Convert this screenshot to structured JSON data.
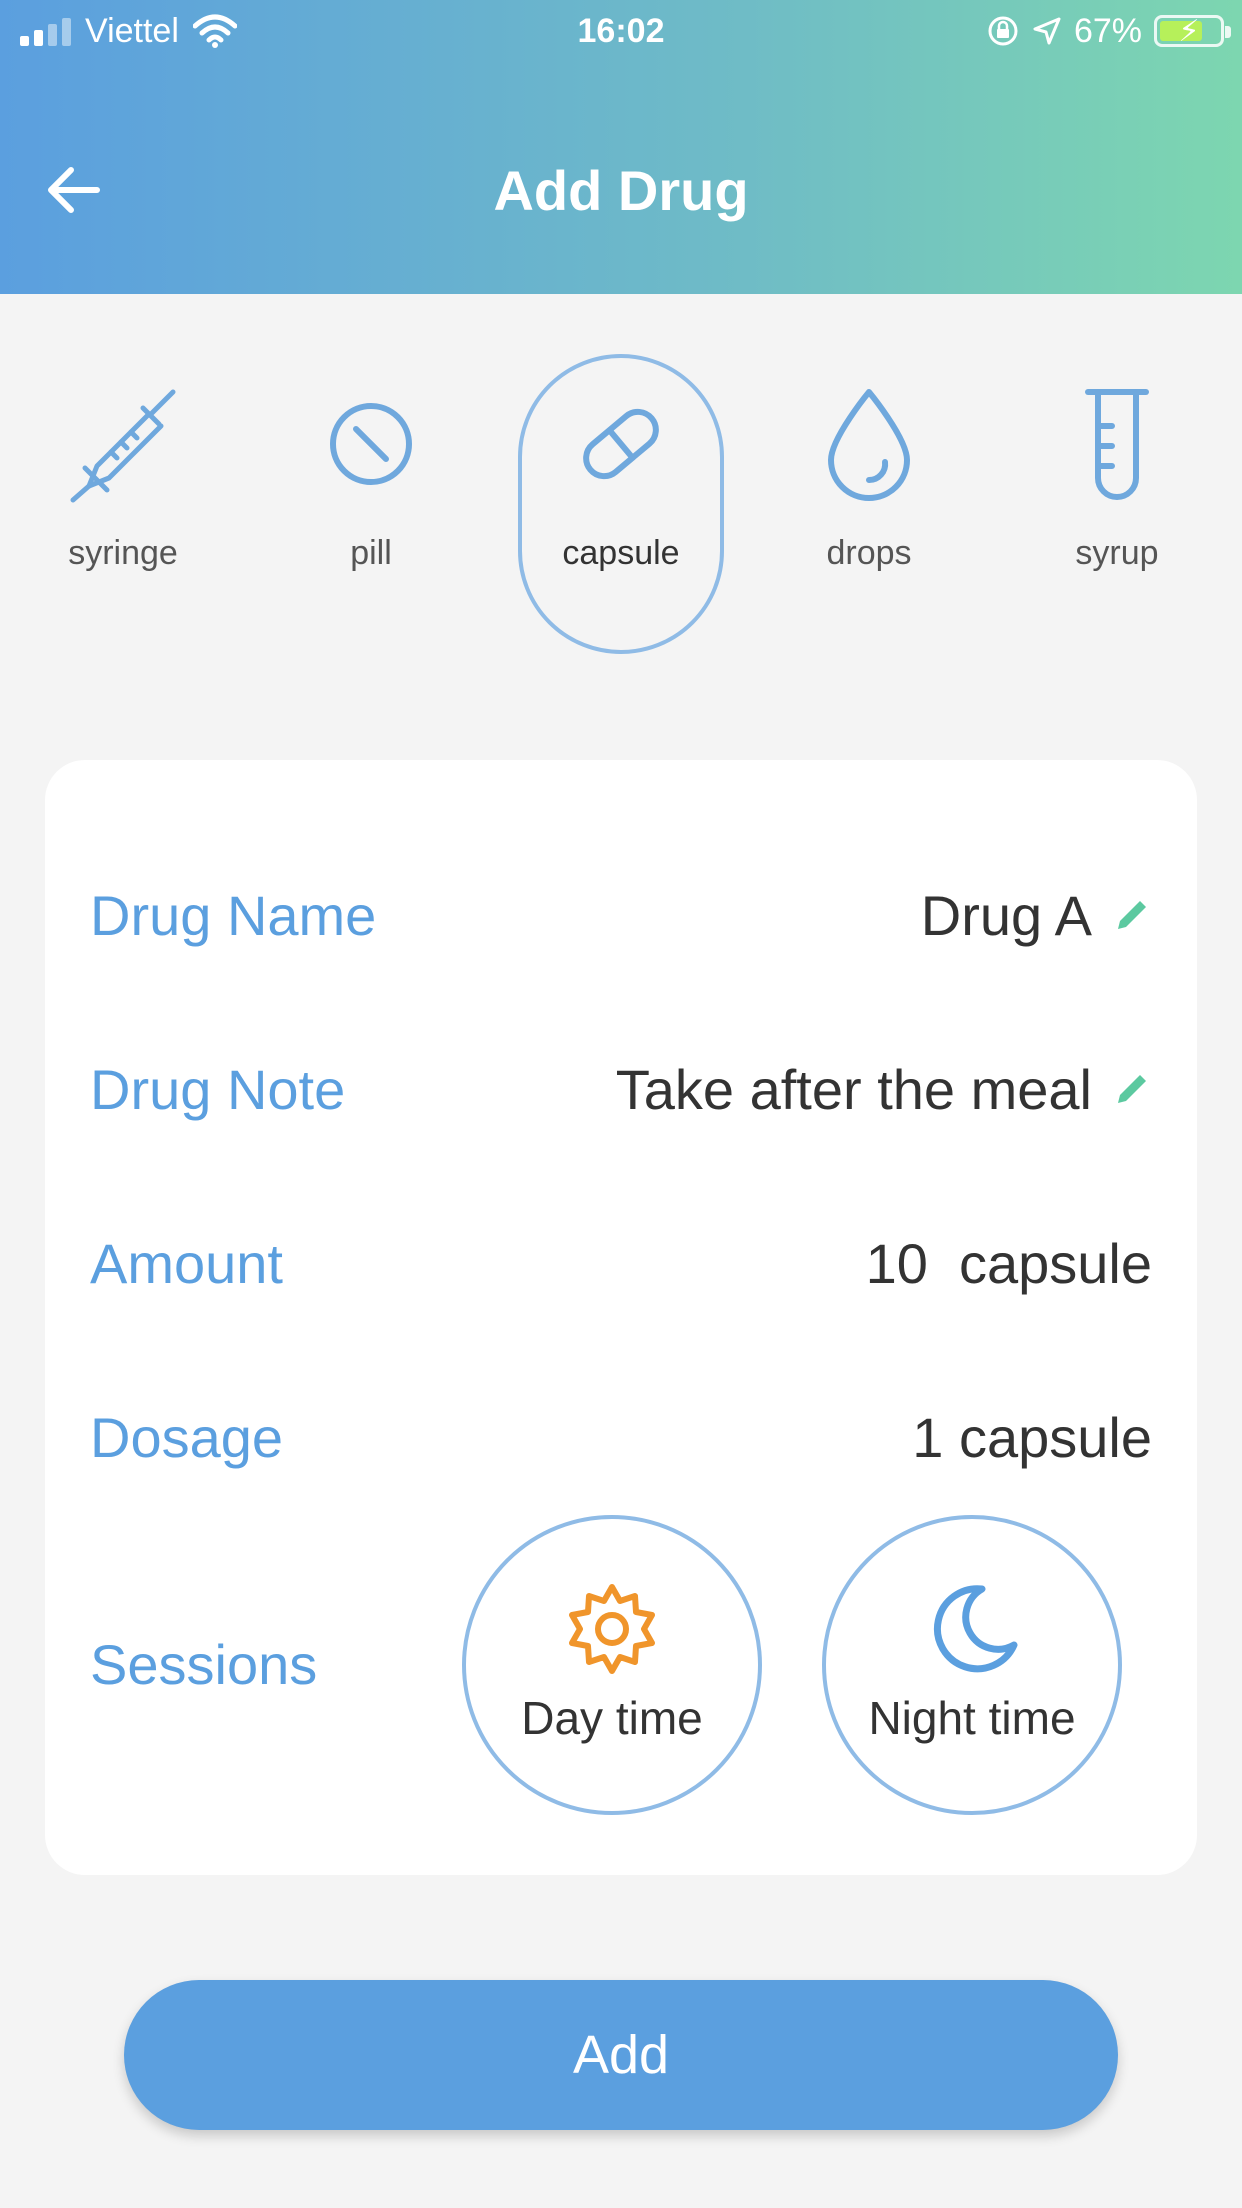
{
  "status": {
    "carrier": "Viettel",
    "time": "16:02",
    "battery": "67%"
  },
  "header": {
    "title": "Add Drug"
  },
  "types": [
    {
      "label": "syringe",
      "icon": "syringe-icon"
    },
    {
      "label": "pill",
      "icon": "pill-icon"
    },
    {
      "label": "capsule",
      "icon": "capsule-icon",
      "selected": true
    },
    {
      "label": "drops",
      "icon": "drop-icon"
    },
    {
      "label": "syrup",
      "icon": "test-tube-icon"
    }
  ],
  "form": {
    "drug_name_label": "Drug Name",
    "drug_name_value": "Drug A",
    "drug_note_label": "Drug Note",
    "drug_note_value": "Take after the meal",
    "amount_label": "Amount",
    "amount_value": "10  capsule",
    "dosage_label": "Dosage",
    "dosage_value": "1 capsule",
    "sessions_label": "Sessions",
    "day_label": "Day time",
    "night_label": "Night time"
  },
  "actions": {
    "add_label": "Add"
  },
  "colors": {
    "accent": "#5b9fdf",
    "pencil": "#5cc9a0",
    "sun": "#f0952b",
    "icon_blue": "#6fa8dd"
  }
}
